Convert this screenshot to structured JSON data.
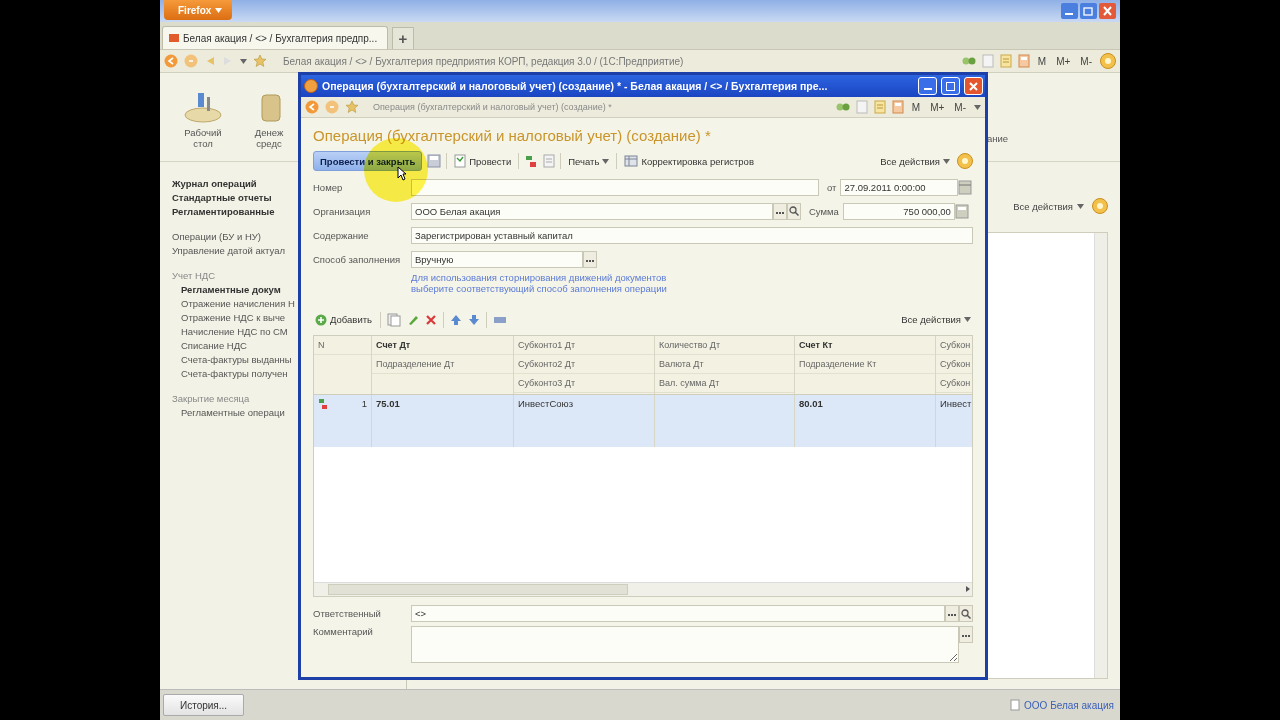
{
  "browser": {
    "menu_button": "Firefox",
    "tabs": [
      {
        "title": "Белая акация / <> / Бухгалтерия предпр..."
      }
    ],
    "new_tab": "+"
  },
  "app_toolbar": {
    "title": "Белая акация / <> / Бухгалтерия предприятия КОРП, редакция 3.0 / (1С:Предприятие)",
    "memory_buttons": [
      "M",
      "M+",
      "M-"
    ]
  },
  "sections": [
    {
      "label": "Рабочий стол"
    },
    {
      "label": "Денеж средс"
    }
  ],
  "section_fragment": "ание",
  "nav_blocks": [
    {
      "items": [
        {
          "label": "Журнал операций",
          "kind": "important"
        },
        {
          "label": "Стандартные отчеты",
          "kind": "important"
        },
        {
          "label": "Регламентированные",
          "kind": "important"
        }
      ]
    },
    {
      "items": [
        {
          "label": "Операции (БУ и НУ)",
          "kind": "normal"
        },
        {
          "label": "Управление датой актуал",
          "kind": "normal"
        }
      ]
    },
    {
      "title": "Учет НДС",
      "items": [
        {
          "label": "Регламентные докум",
          "kind": "important"
        },
        {
          "label": "Отражение начисления Н",
          "kind": "normal"
        },
        {
          "label": "Отражение НДС к выче",
          "kind": "normal"
        },
        {
          "label": "Начисление НДС по СМ",
          "kind": "normal"
        },
        {
          "label": "Списание НДС",
          "kind": "normal"
        },
        {
          "label": "Счета-фактуры выданны",
          "kind": "normal"
        },
        {
          "label": "Счета-фактуры получен",
          "kind": "normal"
        }
      ]
    },
    {
      "title": "Закрытие месяца",
      "items": [
        {
          "label": "Регламентные операци",
          "kind": "normal"
        }
      ]
    }
  ],
  "background_actions": "Все действия",
  "dialog": {
    "window_title": "Операция (бухгалтерский и налоговый учет) (создание) * - Белая акация / <> / Бухгалтерия пре...",
    "inner_title": "Операция (бухгалтерский и налоговый учет) (создание) *",
    "memory_buttons": [
      "M",
      "M+",
      "M-"
    ],
    "form_title": "Операция (бухгалтерский и налоговый учет) (создание) *",
    "commands": [
      {
        "label": "Провести и закрыть",
        "kind": "default"
      },
      {
        "kind": "save"
      },
      {
        "label": "Провести",
        "kind": "post"
      },
      {
        "kind": "movements"
      },
      {
        "kind": "report"
      },
      {
        "label": "Печать",
        "kind": "menu"
      },
      {
        "label": "Корректировка регистров",
        "kind": "registers"
      }
    ],
    "all_actions": "Все действия",
    "number": {
      "label": "Номер"
    },
    "date": {
      "label": "от",
      "value": "27.09.2011  0:00:00"
    },
    "organization": {
      "label": "Организация",
      "value": "ООО Белая акация"
    },
    "amount": {
      "label": "Сумма",
      "value": "750 000,00"
    },
    "content": {
      "label": "Содержание",
      "value": "Зарегистрирован уставный капитал"
    },
    "fill_method": {
      "label": "Способ заполнения",
      "value": "Вручную"
    },
    "hint": "Для использования сторнирования движений документов выберите соответствующий способ заполнения операции",
    "table_toolbar": {
      "add": "Добавить",
      "all_actions": "Все действия"
    },
    "table": {
      "columns": [
        {
          "kind": "number",
          "headers": [
            "N"
          ]
        },
        {
          "kind": "account",
          "headers": [
            "Счет Дт",
            "Подразделение Дт"
          ]
        },
        {
          "kind": "text",
          "headers": [
            "Субконто1 Дт",
            "Субконто2 Дт",
            "Субконто3 Дт"
          ]
        },
        {
          "kind": "text",
          "headers": [
            "Количество Дт",
            "Валюта Дт",
            "Вал. сумма Дт"
          ]
        },
        {
          "kind": "account",
          "headers": [
            "Счет Кт",
            "Подразделение Кт"
          ]
        },
        {
          "kind": "text",
          "headers": [
            "Субкон",
            "Субкон",
            "Субкон"
          ]
        }
      ],
      "rows": [
        {
          "selected": true,
          "cells": [
            "1",
            "75.01",
            "ИнвестСоюз",
            null,
            "80.01",
            "Инвест"
          ]
        }
      ]
    },
    "responsible": {
      "label": "Ответственный",
      "value": "<>"
    },
    "comment": {
      "label": "Комментарий"
    }
  },
  "status_bar": {
    "history_button": "История...",
    "organization": "ООО Белая акация"
  }
}
